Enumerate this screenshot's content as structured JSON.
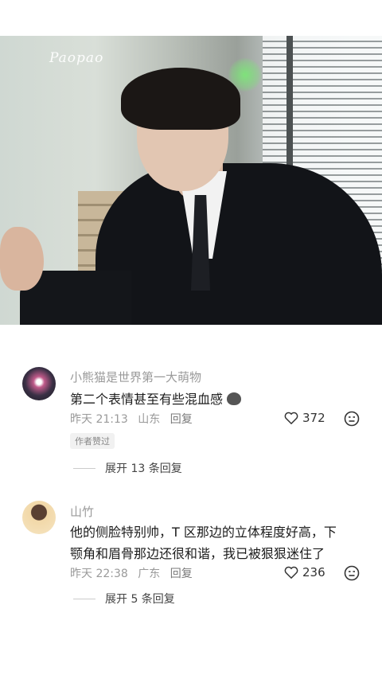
{
  "video": {
    "watermark": "Paopao"
  },
  "comments": [
    {
      "username": "小熊猫是世界第一大萌物",
      "text": "第二个表情甚至有些混血感",
      "emoji_icon": "cat-face-icon",
      "time": "昨天 21:13",
      "location": "山东",
      "reply_label": "回复",
      "likes": "372",
      "badge": "作者赞过",
      "expand": "展开 13 条回复"
    },
    {
      "username": "山竹",
      "text": "他的侧脸特别帅，T 区那边的立体程度好高，下颚角和眉骨那边还很和谐，我已被狠狠迷住了",
      "time": "昨天 22:38",
      "location": "广东",
      "reply_label": "回复",
      "likes": "236",
      "expand": "展开 5 条回复"
    }
  ]
}
